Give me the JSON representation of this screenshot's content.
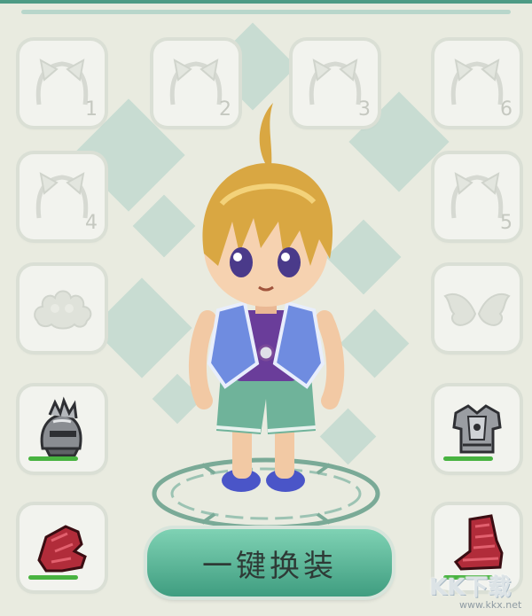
{
  "slots": {
    "accessory_1": {
      "number": "1"
    },
    "accessory_2": {
      "number": "2"
    },
    "accessory_3": {
      "number": "3"
    },
    "accessory_4": {
      "number": "4"
    },
    "accessory_5": {
      "number": "5"
    },
    "accessory_6": {
      "number": "6"
    },
    "mount": {
      "icon": "cloud-pet-placeholder-icon"
    },
    "wings": {
      "icon": "wings-placeholder-icon"
    },
    "helmet": {
      "icon": "knight-helmet-icon",
      "durability": 1.0
    },
    "armor": {
      "icon": "plate-armor-icon",
      "durability": 1.0
    },
    "gloves": {
      "icon": "red-gauntlet-icon",
      "durability": 1.0
    },
    "boots": {
      "icon": "red-boot-icon",
      "durability": 1.0
    }
  },
  "equip_button": {
    "label": "一键换装"
  },
  "watermark": {
    "logo": "KK下载",
    "url": "www.kkx.net"
  },
  "colors": {
    "accent": "#4d9b85",
    "background": "#e9ebe0",
    "durability": "#48b340"
  }
}
